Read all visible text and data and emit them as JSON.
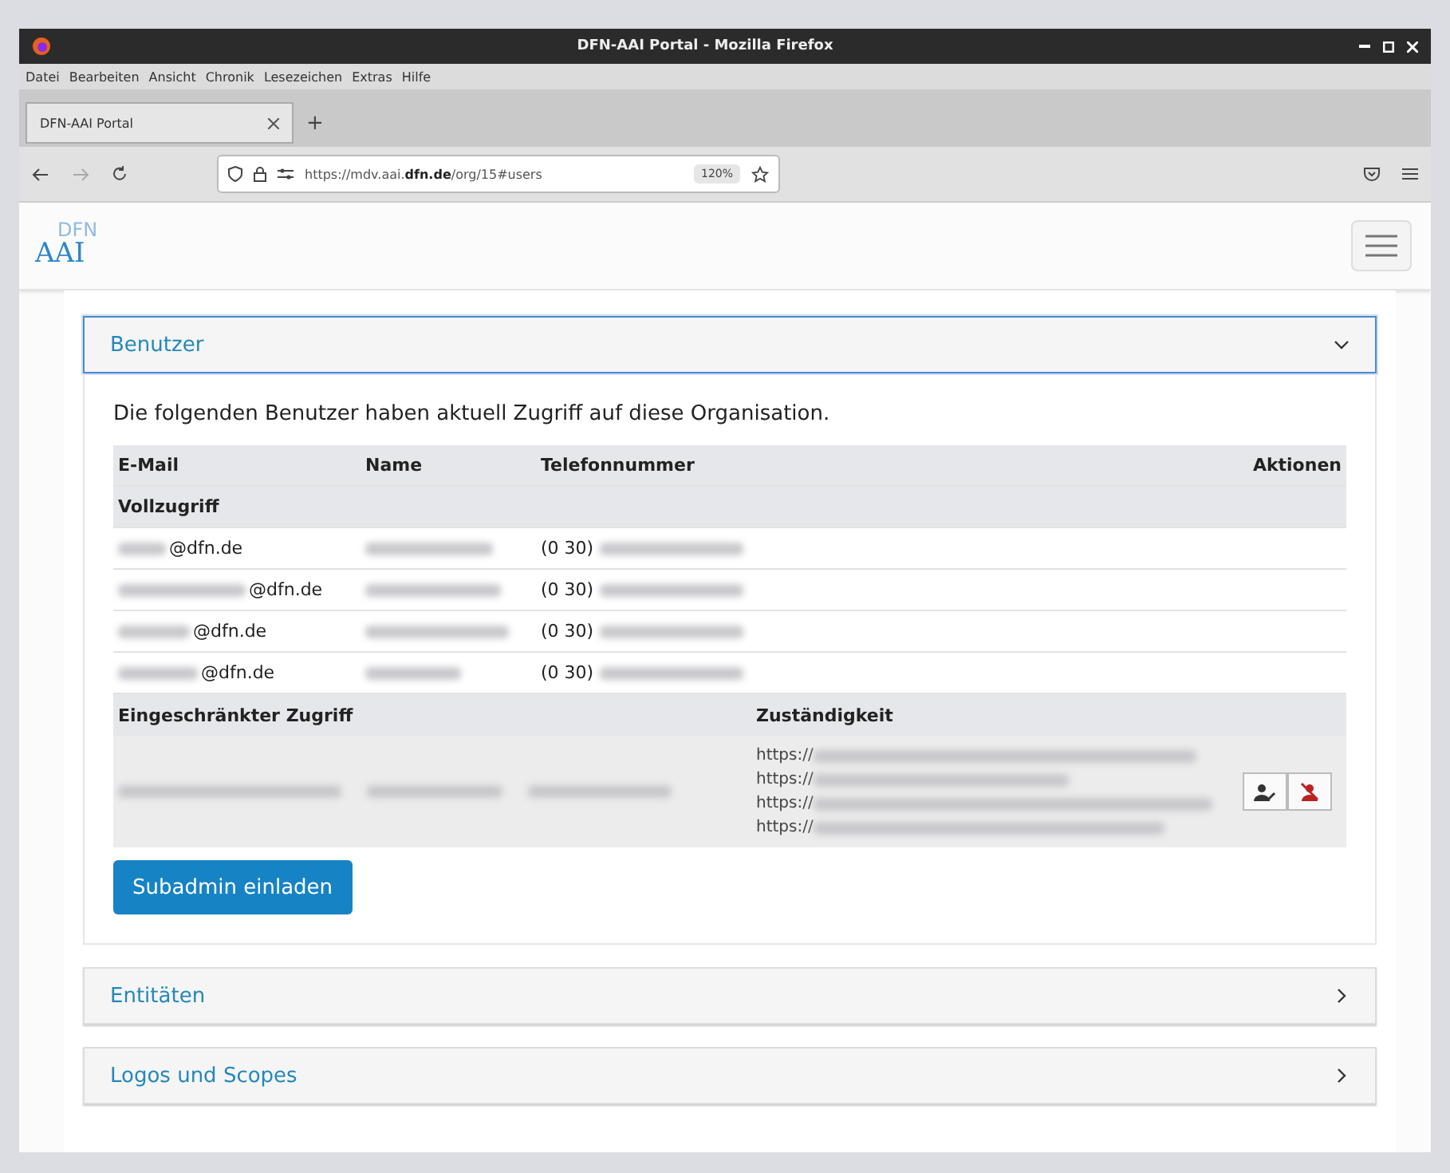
{
  "window": {
    "title": "DFN-AAI Portal - Mozilla Firefox"
  },
  "menu": [
    "Datei",
    "Bearbeiten",
    "Ansicht",
    "Chronik",
    "Lesezeichen",
    "Extras",
    "Hilfe"
  ],
  "tabs": [
    {
      "label": "DFN-AAI Portal",
      "selected": true
    }
  ],
  "new_tab": "+",
  "address": {
    "url": "https://mdv.aai.**dfn.de**/org/15#users",
    "zoom": "120%"
  },
  "logo": {
    "top": "DFN",
    "main": "AAI"
  },
  "sections": [
    {
      "title": "Benutzer",
      "expanded": true,
      "intro": "Die folgenden Benutzer haben aktuell Zugriff auf diese Organisation.",
      "columns": [
        "E-Mail",
        "Name",
        "Telefonnummer",
        "Aktionen"
      ],
      "full_group": {
        "label": "Vollzugriff",
        "rows": [
          {
            "email": "@dfn.de",
            "phone": "(0 30)"
          },
          {
            "email": "@dfn.de",
            "phone": "(0 30)"
          },
          {
            "email": "@dfn.de",
            "phone": "(0 30)"
          },
          {
            "email": "@dfn.de",
            "phone": "(0 30)"
          }
        ]
      },
      "restricted_group": {
        "label": "Eingeschränkter Zugriff",
        "scope_label": "Zuständigkeit",
        "rows": [
          {
            "scopes": [
              "https://",
              "https://",
              "https://",
              "https://"
            ]
          }
        ]
      },
      "invite_button": "Subadmin einladen"
    },
    {
      "title": "Entitäten",
      "expanded": false
    },
    {
      "title": "Logos und Scopes",
      "expanded": false
    }
  ]
}
